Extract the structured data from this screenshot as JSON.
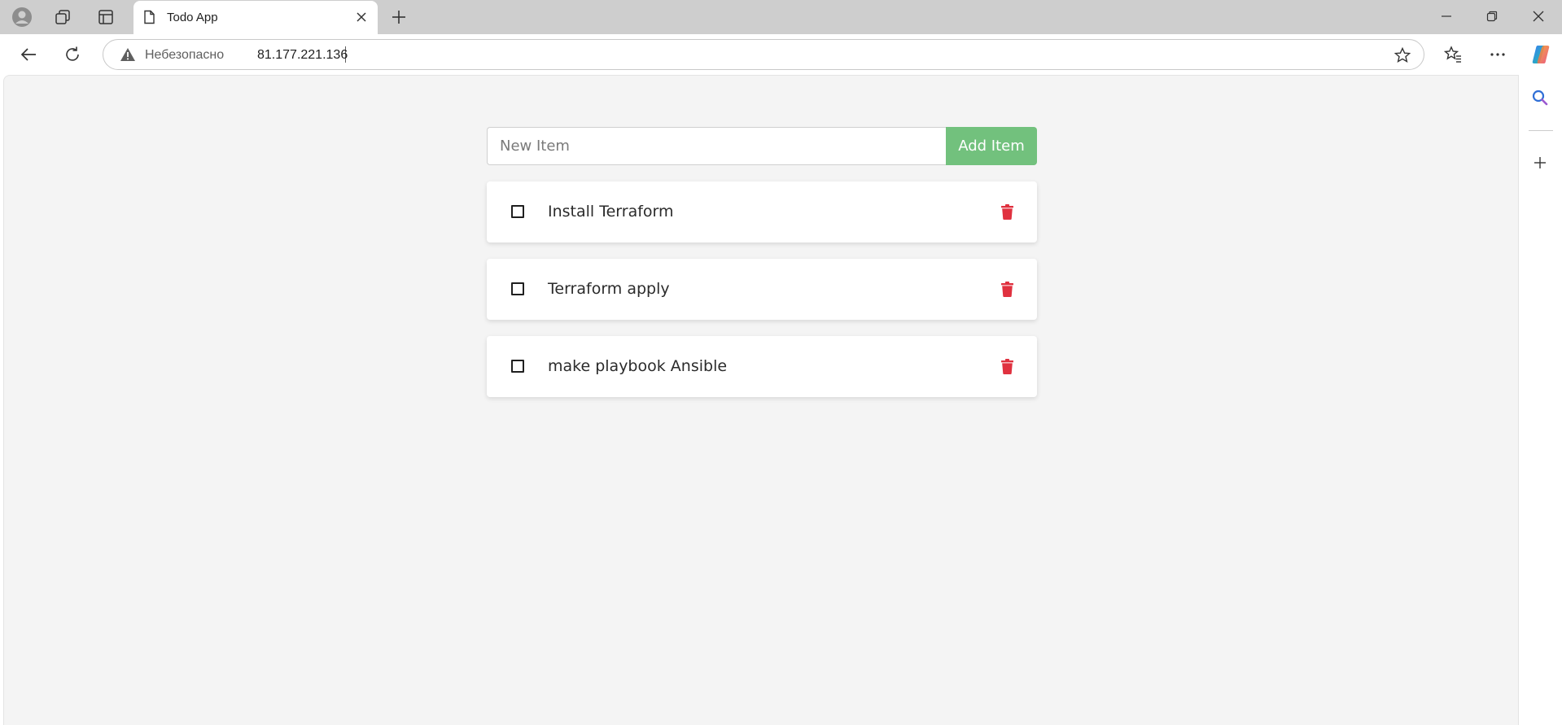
{
  "browser": {
    "tab": {
      "title": "Todo App"
    },
    "address_bar": {
      "security_label": "Небезопасно",
      "url": "81.177.221.136"
    },
    "icons": {
      "profile": "profile-icon",
      "workspaces": "workspaces-icon",
      "tab_actions": "tab-actions-icon",
      "page": "page-icon",
      "close_tab": "close-icon",
      "new_tab": "plus-icon",
      "back": "arrow-left-icon",
      "refresh": "refresh-icon",
      "warning": "warning-icon",
      "favorite": "star-icon",
      "favorites": "favorites-icon",
      "more": "more-icon",
      "copilot": "copilot-icon",
      "search": "search-icon",
      "add": "plus-icon"
    }
  },
  "todo": {
    "input": {
      "placeholder": "New Item",
      "value": ""
    },
    "add_button_label": "Add Item",
    "items": [
      {
        "text": "Install Terraform",
        "checked": false
      },
      {
        "text": "Terraform apply",
        "checked": false
      },
      {
        "text": "make playbook Ansible",
        "checked": false
      }
    ]
  },
  "colors": {
    "add_button": "#72c17d",
    "delete_icon": "#e0313f",
    "page_background": "#f4f4f4",
    "tabstrip": "#cecece"
  }
}
